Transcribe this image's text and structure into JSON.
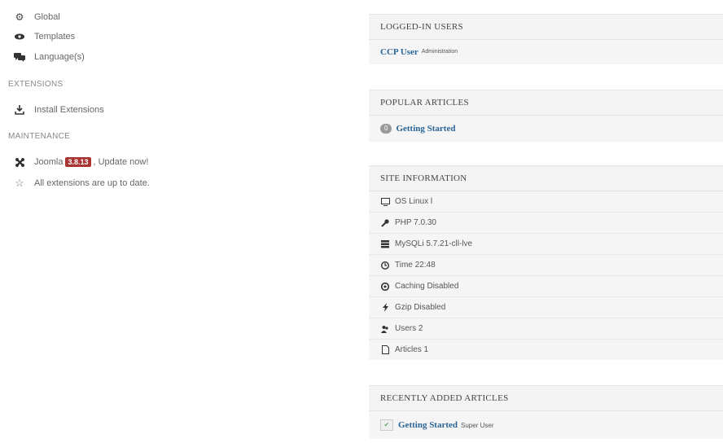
{
  "sidebar": {
    "items": [
      {
        "label": "Global",
        "icon": "gear-icon"
      },
      {
        "label": "Templates",
        "icon": "eye-icon"
      },
      {
        "label": "Language(s)",
        "icon": "comments-icon"
      }
    ],
    "extensions_heading": "EXTENSIONS",
    "install_label": "Install Extensions",
    "maintenance_heading": "MAINTENANCE",
    "joomla_prefix": "Joomla",
    "joomla_version": "3.8.13",
    "joomla_suffix": ", Update now!",
    "extensions_status": "All extensions are up to date."
  },
  "logged_in": {
    "title": "LOGGED-IN USERS",
    "user": "CCP User",
    "role": "Administration"
  },
  "popular": {
    "title": "POPULAR ARTICLES",
    "hits": "0",
    "article": "Getting Started"
  },
  "site_info": {
    "title": "SITE INFORMATION",
    "rows": [
      {
        "label": "OS Linux l",
        "icon": "monitor-icon"
      },
      {
        "label": "PHP 7.0.30",
        "icon": "wrench-icon"
      },
      {
        "label": "MySQLi 5.7.21-cll-lve",
        "icon": "database-icon"
      },
      {
        "label": "Time 22:48",
        "icon": "clock-icon"
      },
      {
        "label": "Caching Disabled",
        "icon": "dashboard-icon"
      },
      {
        "label": "Gzip Disabled",
        "icon": "flash-icon"
      },
      {
        "label": "Users 2",
        "icon": "users-icon"
      },
      {
        "label": "Articles 1",
        "icon": "file-icon"
      }
    ]
  },
  "recent": {
    "title": "RECENTLY ADDED ARTICLES",
    "article": "Getting Started",
    "author": "Super User"
  }
}
